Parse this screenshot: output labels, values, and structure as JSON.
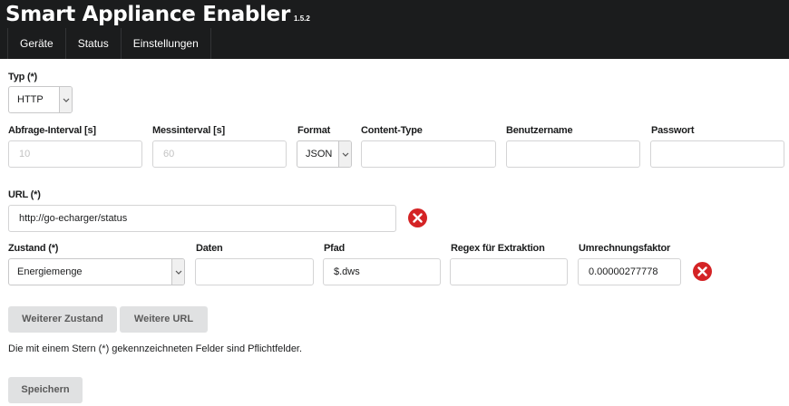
{
  "app": {
    "title": "Smart Appliance Enabler",
    "version": "1.5.2"
  },
  "nav": {
    "items": [
      "Geräte",
      "Status",
      "Einstellungen"
    ]
  },
  "form": {
    "typ": {
      "label": "Typ (*)",
      "value": "HTTP"
    },
    "abfrage": {
      "label": "Abfrage-Interval [s]",
      "placeholder": "10"
    },
    "messinterval": {
      "label": "Messinterval [s]",
      "placeholder": "60"
    },
    "format": {
      "label": "Format",
      "value": "JSON"
    },
    "content_type": {
      "label": "Content-Type",
      "value": ""
    },
    "benutzername": {
      "label": "Benutzername",
      "value": ""
    },
    "passwort": {
      "label": "Passwort",
      "value": ""
    },
    "url": {
      "label": "URL (*)",
      "value": "http://go-echarger/status"
    },
    "zustand": {
      "label": "Zustand (*)",
      "value": "Energiemenge"
    },
    "daten": {
      "label": "Daten",
      "value": ""
    },
    "pfad": {
      "label": "Pfad",
      "value": "$.dws"
    },
    "regex": {
      "label": "Regex für Extraktion",
      "value": ""
    },
    "faktor": {
      "label": "Umrechnungsfaktor",
      "value": "0.00000277778"
    }
  },
  "buttons": {
    "weiterer_zustand": "Weiterer Zustand",
    "weitere_url": "Weitere URL",
    "speichern": "Speichern"
  },
  "note": "Die mit einem Stern (*) gekennzeichneten Felder sind Pflichtfelder.",
  "colors": {
    "header_bg": "#1b1c1d",
    "delete_red": "#d42325",
    "button_bg": "#e0e1e2"
  },
  "icons": {
    "delete": "delete-x-circle-icon",
    "select": "chevron-down-icon"
  }
}
